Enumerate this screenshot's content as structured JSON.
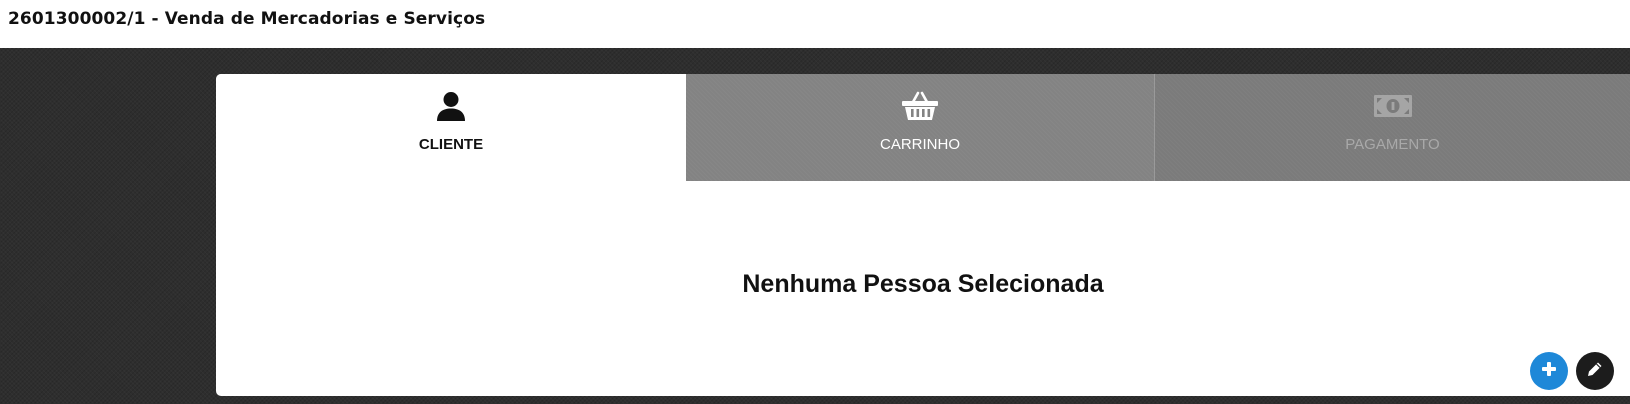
{
  "window": {
    "title": "2601300002/1 - Venda de Mercadorias e Serviços"
  },
  "tabs": [
    {
      "label": "CLIENTE",
      "icon": "person-icon",
      "state": "active"
    },
    {
      "label": "CARRINHO",
      "icon": "basket-icon",
      "state": "available"
    },
    {
      "label": "PAGAMENTO",
      "icon": "money-icon",
      "state": "disabled"
    }
  ],
  "content": {
    "message": "Nenhuma Pessoa Selecionada"
  },
  "actions": {
    "add_icon": "plus-icon",
    "edit_icon": "pencil-icon"
  },
  "colors": {
    "add_button": "#1e88d8",
    "edit_button": "#1c1c1c",
    "tab_cart": "#838383",
    "tab_payment": "#7b7b7b",
    "background": "#2e2e2e"
  }
}
